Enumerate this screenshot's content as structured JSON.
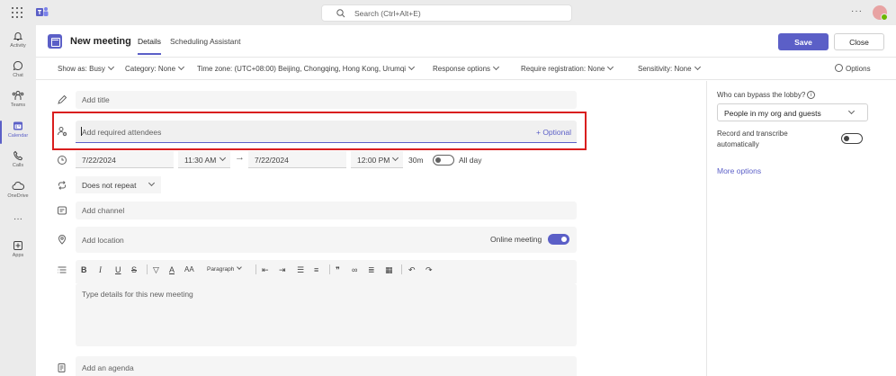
{
  "topbar": {
    "search_placeholder": "Search (Ctrl+Alt+E)",
    "more": "···"
  },
  "rail": {
    "items": [
      {
        "label": "Activity",
        "icon": "bell-icon"
      },
      {
        "label": "Chat",
        "icon": "chat-icon"
      },
      {
        "label": "Teams",
        "icon": "teams-icon"
      },
      {
        "label": "Calendar",
        "icon": "calendar-icon",
        "active": true
      },
      {
        "label": "Calls",
        "icon": "phone-icon"
      },
      {
        "label": "OneDrive",
        "icon": "cloud-icon"
      },
      {
        "label": "···",
        "icon": "more-icon"
      },
      {
        "label": "Apps",
        "icon": "apps-icon"
      }
    ]
  },
  "header": {
    "title": "New meeting",
    "tabs": [
      "Details",
      "Scheduling Assistant"
    ],
    "save_label": "Save",
    "close_label": "Close"
  },
  "options_bar": {
    "show_as": "Show as: Busy",
    "category": "Category: None",
    "timezone": "Time zone: (UTC+08:00) Beijing, Chongqing, Hong Kong, Urumqi",
    "response": "Response options",
    "registration": "Require registration: None",
    "sensitivity": "Sensitivity: None",
    "options": "Options"
  },
  "form": {
    "title_placeholder": "Add title",
    "attendees_placeholder": "Add required attendees",
    "optional_label": "+ Optional",
    "start_date": "7/22/2024",
    "start_time": "11:30 AM",
    "end_date": "7/22/2024",
    "end_time": "12:00 PM",
    "duration": "30m",
    "all_day_label": "All day",
    "repeat": "Does not repeat",
    "channel_placeholder": "Add channel",
    "location_placeholder": "Add location",
    "online_meeting_label": "Online meeting",
    "paragraph_label": "Paragraph",
    "details_placeholder": "Type details for this new meeting",
    "agenda_placeholder": "Add an agenda"
  },
  "side_panel": {
    "lobby_question": "Who can bypass the lobby?",
    "info": "i",
    "lobby_value": "People in my org and guests",
    "record_label": "Record and transcribe automatically",
    "more_options": "More options"
  },
  "colors": {
    "accent": "#5b5fc7",
    "highlight": "#d91e1e"
  }
}
